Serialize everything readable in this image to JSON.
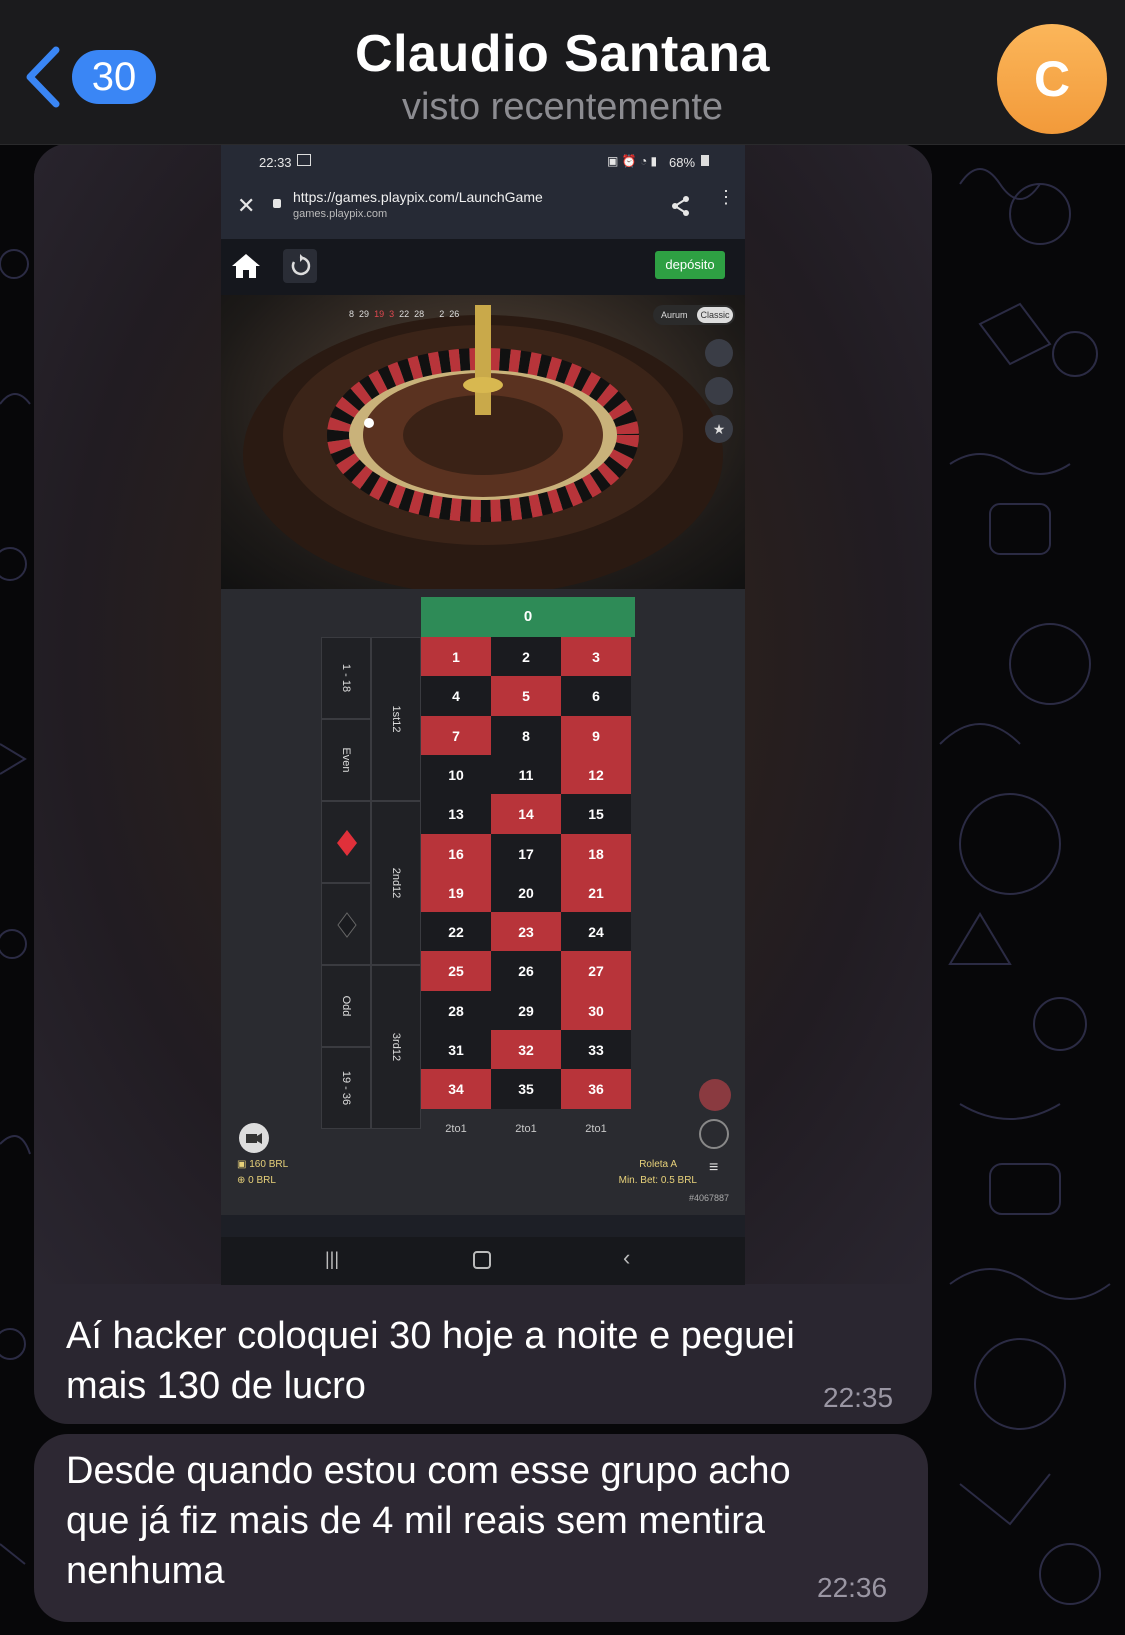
{
  "header": {
    "back_count": "30",
    "contact_name": "Claudio Santana",
    "status": "visto recentemente",
    "avatar_letter": "C"
  },
  "phone": {
    "status_time": "22:33",
    "status_battery": "68%",
    "url": "https://games.playpix.com/LaunchGame",
    "url_domain": "games.playpix.com",
    "deposit_label": "depósito",
    "toggle_left": "Aurum",
    "toggle_right": "Classic",
    "recent_numbers": [
      "8",
      "29",
      "19",
      "3",
      "22",
      "28",
      "",
      "2",
      "26"
    ],
    "zero": "0",
    "grid": [
      [
        "1",
        "2",
        "3"
      ],
      [
        "4",
        "5",
        "6"
      ],
      [
        "7",
        "8",
        "9"
      ],
      [
        "10",
        "11",
        "12"
      ],
      [
        "13",
        "14",
        "15"
      ],
      [
        "16",
        "17",
        "18"
      ],
      [
        "19",
        "20",
        "21"
      ],
      [
        "22",
        "23",
        "24"
      ],
      [
        "25",
        "26",
        "27"
      ],
      [
        "28",
        "29",
        "30"
      ],
      [
        "31",
        "32",
        "33"
      ],
      [
        "34",
        "35",
        "36"
      ]
    ],
    "grid_colors": [
      [
        "red",
        "black",
        "red"
      ],
      [
        "black",
        "red",
        "black"
      ],
      [
        "red",
        "black",
        "red"
      ],
      [
        "black",
        "black",
        "red"
      ],
      [
        "black",
        "red",
        "black"
      ],
      [
        "red",
        "black",
        "red"
      ],
      [
        "red",
        "black",
        "red"
      ],
      [
        "black",
        "red",
        "black"
      ],
      [
        "red",
        "black",
        "red"
      ],
      [
        "black",
        "black",
        "red"
      ],
      [
        "black",
        "red",
        "black"
      ],
      [
        "red",
        "black",
        "red"
      ]
    ],
    "column_bets": [
      "2to1",
      "2to1",
      "2to1"
    ],
    "dozens": [
      "1st12",
      "2nd12",
      "3rd12"
    ],
    "outside": [
      "1 - 18",
      "Even",
      "",
      "",
      "Odd",
      "19 - 36"
    ],
    "balance": "160 BRL",
    "bet_total": "0 BRL",
    "table_name": "Roleta A",
    "min_bet": "Min. Bet: 0.5 BRL",
    "round_id": "#4067887"
  },
  "messages": [
    {
      "text_line1": "Aí hacker coloquei 30 hoje a noite e peguei",
      "text_line2": "mais 130 de lucro",
      "time": "22:35"
    },
    {
      "text_line1": "Desde quando estou com esse grupo acho",
      "text_line2": "que já fiz mais de 4 mil reais sem mentira",
      "text_line3": "nenhuma",
      "time": "22:36"
    }
  ],
  "colors": {
    "accent": "#3a86f5",
    "avatar": "#f5a847",
    "bubble": "#2d2833",
    "roulette_red": "#b8343a",
    "roulette_green": "#2e8b57",
    "deposit_green": "#2ea043"
  }
}
